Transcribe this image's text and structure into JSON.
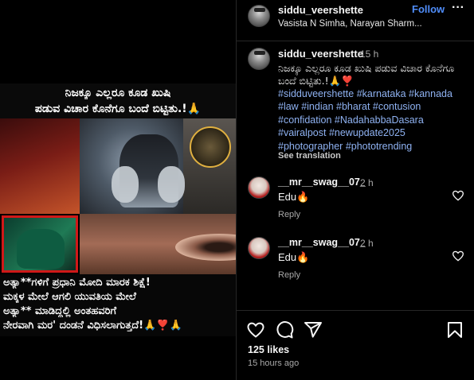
{
  "media": {
    "top_text_line1": "ನಿಜಕ್ಕೂ ಎಲ್ಲರೂ ಕೂಡ ಖುಷಿ",
    "top_text_line2": "ಪಡುವ ವಿಚಾರ ಕೊನೆಗೂ ಬಂದೆ ಬಿಟ್ಟಿತು.!🙏",
    "bottom_text_line1": "ಅತ್ಯಾ**ಗಳಿಗೆ ಪ್ರಧಾನಿ ಮೋದಿ ಮಾರಕ ಶಿಕ್ಷೆ!",
    "bottom_text_line2": "ಮಕ್ಕಳ ಮೇಲೆ ಆಗಲಿ ಯುವತಿಯ ಮೇಲೆ",
    "bottom_text_line3": "ಅತ್ಯಾ** ಮಾಡಿದ್ದಲ್ಲಿ ಅಂತಹವರಿಗೆ",
    "bottom_text_line4": "ನೇರವಾಗಿ ಮರ' ದಂಡನೆ ವಿಧಿಸಲಾಗುತ್ತದೆ!🙏❣️🙏"
  },
  "header": {
    "username": "siddu_veershette",
    "separator": "•",
    "follow_label": "Follow",
    "audio": "Vasista N Simha, Narayan Sharm...",
    "more_label": "···"
  },
  "caption": {
    "username": "siddu_veershette",
    "time": "15 h",
    "text": "ನಿಜಕ್ಕೂ ಎಲ್ಲರೂ ಕೂಡ ಖುಷಿ ಪಡುವ ವಿಚಾರ ಕೊನೆಗೂ ಬಂದೆ ಬಿಟ್ಟಿತು.!🙏❣️",
    "hashtags": [
      "#sidduveershette",
      "#karnataka",
      "#kannada",
      "#law",
      "#indian",
      "#bharat",
      "#contusion",
      "#confidation",
      "#NadahabbaDasara",
      "#vairalpost",
      "#newupdate2025",
      "#photographer",
      "#phototrending"
    ],
    "see_translation": "See translation"
  },
  "comments": [
    {
      "username": "__mr__swag__07_",
      "time": "2 h",
      "text": "Edu🔥",
      "reply": "Reply"
    },
    {
      "username": "__mr__swag__07_",
      "time": "2 h",
      "text": "Edu🔥",
      "reply": "Reply"
    }
  ],
  "footer": {
    "likes": "125 likes",
    "timestamp": "15 hours ago"
  },
  "icons": {
    "like": "heart-icon",
    "comment": "comment-icon",
    "share": "share-icon",
    "save": "bookmark-icon"
  },
  "colors": {
    "background": "#000000",
    "link_blue": "#4f8df9",
    "hashtag": "#8fb2f2",
    "muted": "#a8a8a8"
  }
}
